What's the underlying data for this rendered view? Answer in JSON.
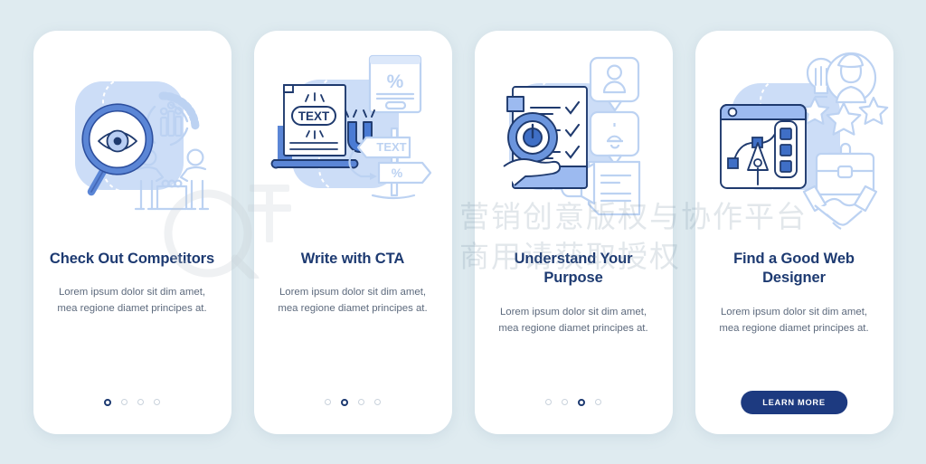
{
  "background_color": "#dfebf0",
  "theme": {
    "card_bg": "#ffffff",
    "title_color": "#1d3a71",
    "body_color": "#5d6a7d",
    "accent_blue": "#5b86d6",
    "pale_blue": "#ccddf7",
    "cta_bg": "#1d3a80",
    "dot_inactive": "#c9d2dc"
  },
  "watermark": {
    "line1": "营销创意版权与协作平台",
    "line2": "商用请获取授权"
  },
  "screens": [
    {
      "id": "check-out-competitors",
      "title": "Check Out Competitors",
      "body": "Lorem ipsum dolor sit dim amet, mea regione diamet principes at.",
      "pagination": {
        "total": 4,
        "active_index": 0
      },
      "cta": null,
      "illustration": {
        "name": "magnifier-eye-analytics-illustration",
        "elements": [
          "magnifying-glass-icon",
          "eye-icon",
          "donut-chart-icon",
          "people-group-icon",
          "meeting-table-icon"
        ]
      }
    },
    {
      "id": "write-with-cta",
      "title": "Write with CTA",
      "body": "Lorem ipsum dolor sit dim amet, mea regione diamet principes at.",
      "pagination": {
        "total": 4,
        "active_index": 1
      },
      "cta": null,
      "illustration": {
        "name": "laptop-magnet-signpost-illustration",
        "elements": [
          "laptop-icon",
          "text-label",
          "magnet-icon",
          "discount-card-icon",
          "percent-label",
          "signpost-icon"
        ],
        "labels": {
          "screen_text": "TEXT",
          "sign_text": "TEXT",
          "percent": "%"
        }
      }
    },
    {
      "id": "understand-your-purpose",
      "title": "Understand Your Purpose",
      "body": "Lorem ipsum dolor sit dim amet, mea regione diamet principes at.",
      "pagination": {
        "total": 4,
        "active_index": 2
      },
      "cta": null,
      "illustration": {
        "name": "checklist-target-notifications-illustration",
        "elements": [
          "checklist-icon",
          "target-bullseye-icon",
          "hand-icon",
          "user-bubble-icon",
          "bell-bubble-icon",
          "document-icon"
        ]
      }
    },
    {
      "id": "find-a-good-web-designer",
      "title": "Find a Good Web Designer",
      "body": "Lorem ipsum dolor sit dim amet, mea regione diamet principes at.",
      "pagination": null,
      "cta": {
        "label": "LEARN MORE"
      },
      "illustration": {
        "name": "design-tool-rating-handshake-illustration",
        "elements": [
          "browser-window-icon",
          "pen-tool-icon",
          "lightbulb-icon",
          "person-rating-icon",
          "star-icon",
          "briefcase-icon",
          "handshake-icon"
        ]
      }
    }
  ]
}
